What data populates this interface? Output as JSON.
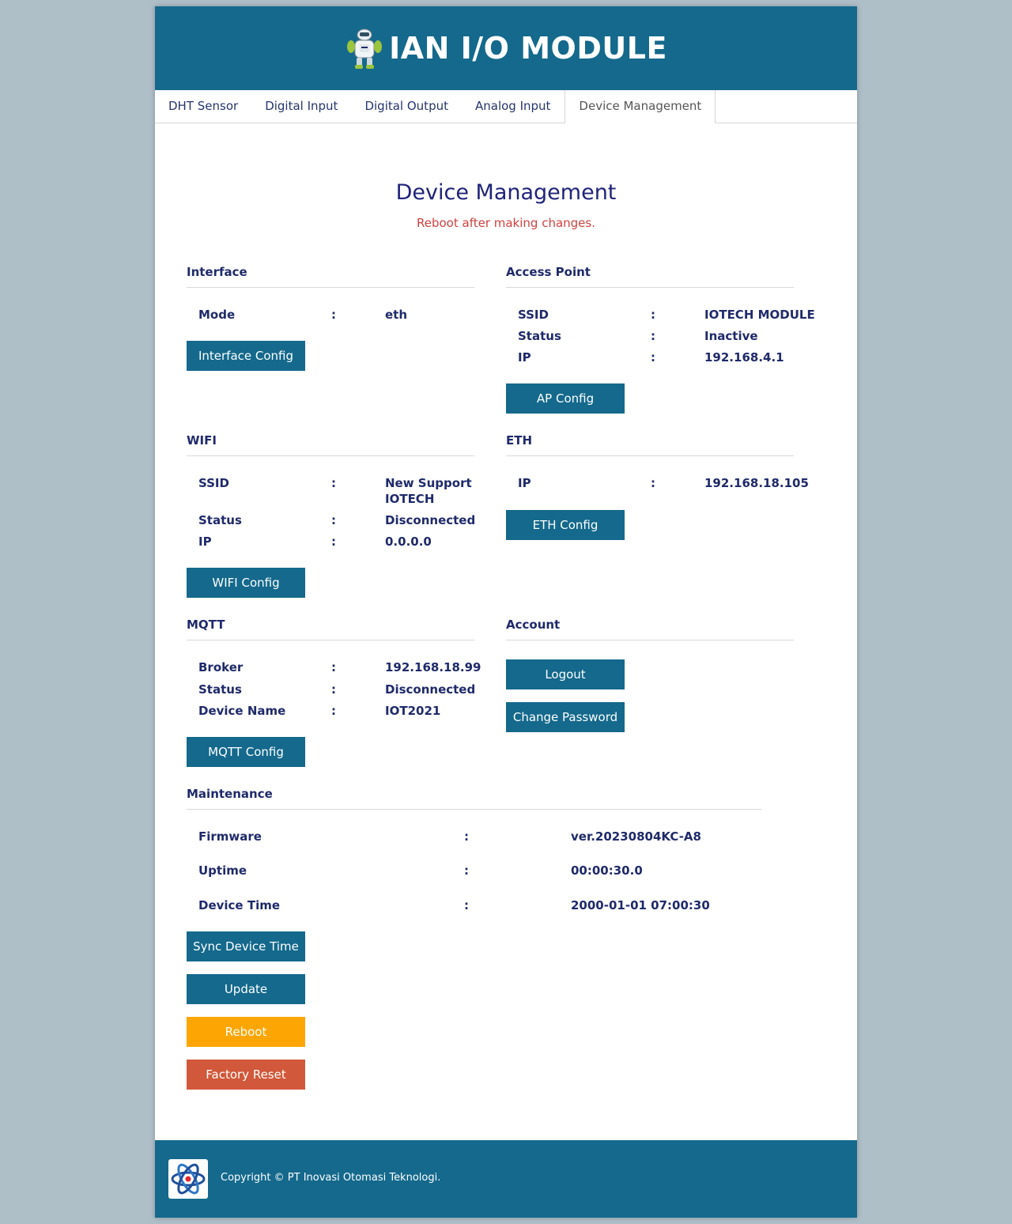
{
  "header": {
    "title": "IAN I/O MODULE",
    "logo_icon": "robot-icon"
  },
  "tabs": [
    {
      "label": "DHT Sensor"
    },
    {
      "label": "Digital Input"
    },
    {
      "label": "Digital Output"
    },
    {
      "label": "Analog Input"
    },
    {
      "label": "Device Management",
      "active": true
    }
  ],
  "page": {
    "title": "Device Management",
    "subtitle": "Reboot after making changes."
  },
  "interface": {
    "title": "Interface",
    "mode_label": "Mode",
    "mode_value": "eth",
    "button": "Interface Config"
  },
  "access_point": {
    "title": "Access Point",
    "ssid_label": "SSID",
    "ssid_value": "IOTECH MODULE",
    "status_label": "Status",
    "status_value": "Inactive",
    "ip_label": "IP",
    "ip_value": "192.168.4.1",
    "button": "AP Config"
  },
  "wifi": {
    "title": "WIFI",
    "ssid_label": "SSID",
    "ssid_value_line1": "New Support",
    "ssid_value_line2": "IOTECH",
    "status_label": "Status",
    "status_value": "Disconnected",
    "ip_label": "IP",
    "ip_value": "0.0.0.0",
    "button": "WIFI Config"
  },
  "eth": {
    "title": "ETH",
    "ip_label": "IP",
    "ip_value": "192.168.18.105",
    "button": "ETH Config"
  },
  "mqtt": {
    "title": "MQTT",
    "broker_label": "Broker",
    "broker_value": "192.168.18.99",
    "status_label": "Status",
    "status_value": "Disconnected",
    "device_label": "Device Name",
    "device_value": "IOT2021",
    "button": "MQTT Config"
  },
  "account": {
    "title": "Account",
    "logout": "Logout",
    "change_password": "Change Password"
  },
  "maintenance": {
    "title": "Maintenance",
    "firmware_label": "Firmware",
    "firmware_value": "ver.20230804KC-A8",
    "uptime_label": "Uptime",
    "uptime_value": "00:00:30.0",
    "time_label": "Device Time",
    "time_value": "2000-01-01 07:00:30",
    "sync": "Sync Device Time",
    "update": "Update",
    "reboot": "Reboot",
    "factory_reset": "Factory Reset"
  },
  "colon": ":",
  "footer": {
    "copyright": "Copyright © PT Inovasi Otomasi Teknologi.",
    "logo_icon": "atom-icon"
  },
  "colors": {
    "primary": "#14698c",
    "warning": "#fda603",
    "danger": "#d1583a",
    "subtitle": "#d1403f",
    "background": "#afbfc8"
  }
}
